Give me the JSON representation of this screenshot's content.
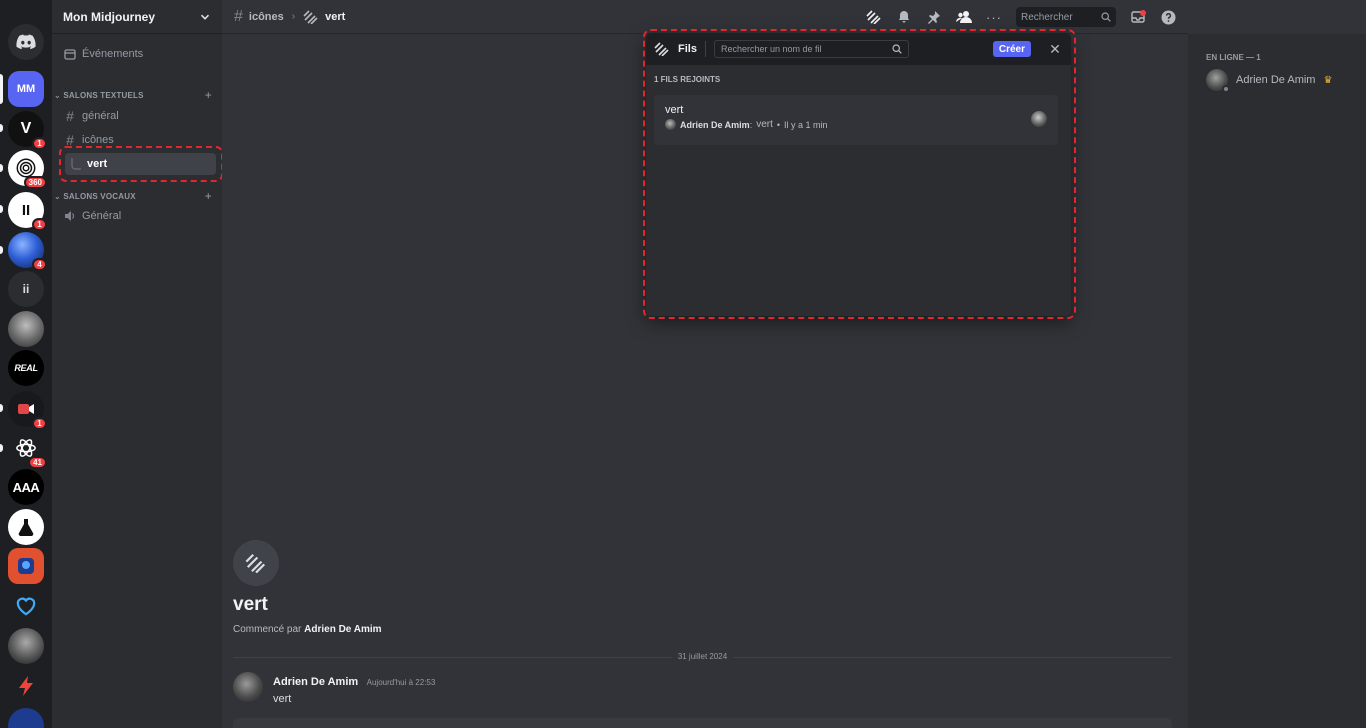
{
  "servers": [
    {
      "label": "",
      "badge": "",
      "icon": "discord-logo-icon"
    },
    {
      "label": "MM",
      "badge": "",
      "icon": ""
    },
    {
      "label": "V",
      "badge": "1",
      "icon": ""
    },
    {
      "label": "",
      "badge": "360",
      "icon": "fingerprint-icon"
    },
    {
      "label": "II",
      "badge": "1",
      "icon": "pause-icon"
    },
    {
      "label": "",
      "badge": "4",
      "icon": "planet-icon"
    },
    {
      "label": "ii",
      "badge": "",
      "icon": ""
    },
    {
      "label": "",
      "badge": "",
      "icon": "portrait-icon"
    },
    {
      "label": "REAL",
      "badge": "",
      "icon": ""
    },
    {
      "label": "",
      "badge": "1",
      "icon": "video-icon"
    },
    {
      "label": "",
      "badge": "41",
      "icon": "orbit-icon"
    },
    {
      "label": "AAA",
      "badge": "",
      "icon": ""
    },
    {
      "label": "",
      "badge": "",
      "icon": "flask-icon"
    },
    {
      "label": "",
      "badge": "",
      "icon": "ai-box-icon"
    },
    {
      "label": "",
      "badge": "",
      "icon": "heart-icon"
    },
    {
      "label": "",
      "badge": "",
      "icon": "portrait-icon"
    },
    {
      "label": "",
      "badge": "",
      "icon": "lightning-icon"
    }
  ],
  "sidebar": {
    "guild_name": "Mon Midjourney",
    "events": "Événements",
    "text_category": "SALONS TEXTUELS",
    "text_channels": [
      "général",
      "icônes"
    ],
    "active_thread": "vert",
    "voice_category": "SALONS VOCAUX",
    "voice_channels": [
      "Général"
    ]
  },
  "topbar": {
    "channel": "icônes",
    "thread": "vert",
    "search_placeholder": "Rechercher"
  },
  "popout": {
    "title": "Fils",
    "search_placeholder": "Rechercher un nom de fil",
    "create_label": "Créer",
    "section": "1 FILS REJOINTS",
    "thread_name": "vert",
    "last_author": "Adrien De Amim",
    "last_message": "vert",
    "last_time": "Il y a 1 min"
  },
  "thread": {
    "title": "vert",
    "started_prefix": "Commencé par",
    "started_by": "Adrien De Amim",
    "date_divider": "31 juillet 2024",
    "message_author": "Adrien De Amim",
    "message_time": "Aujourd'hui à 22:53",
    "message_text": "vert"
  },
  "members": {
    "category": "EN LIGNE — 1",
    "name": "Adrien De Amim"
  },
  "colors": {
    "accent": "#5865f2",
    "highlight": "#e3262e",
    "badge": "#f23f43"
  }
}
